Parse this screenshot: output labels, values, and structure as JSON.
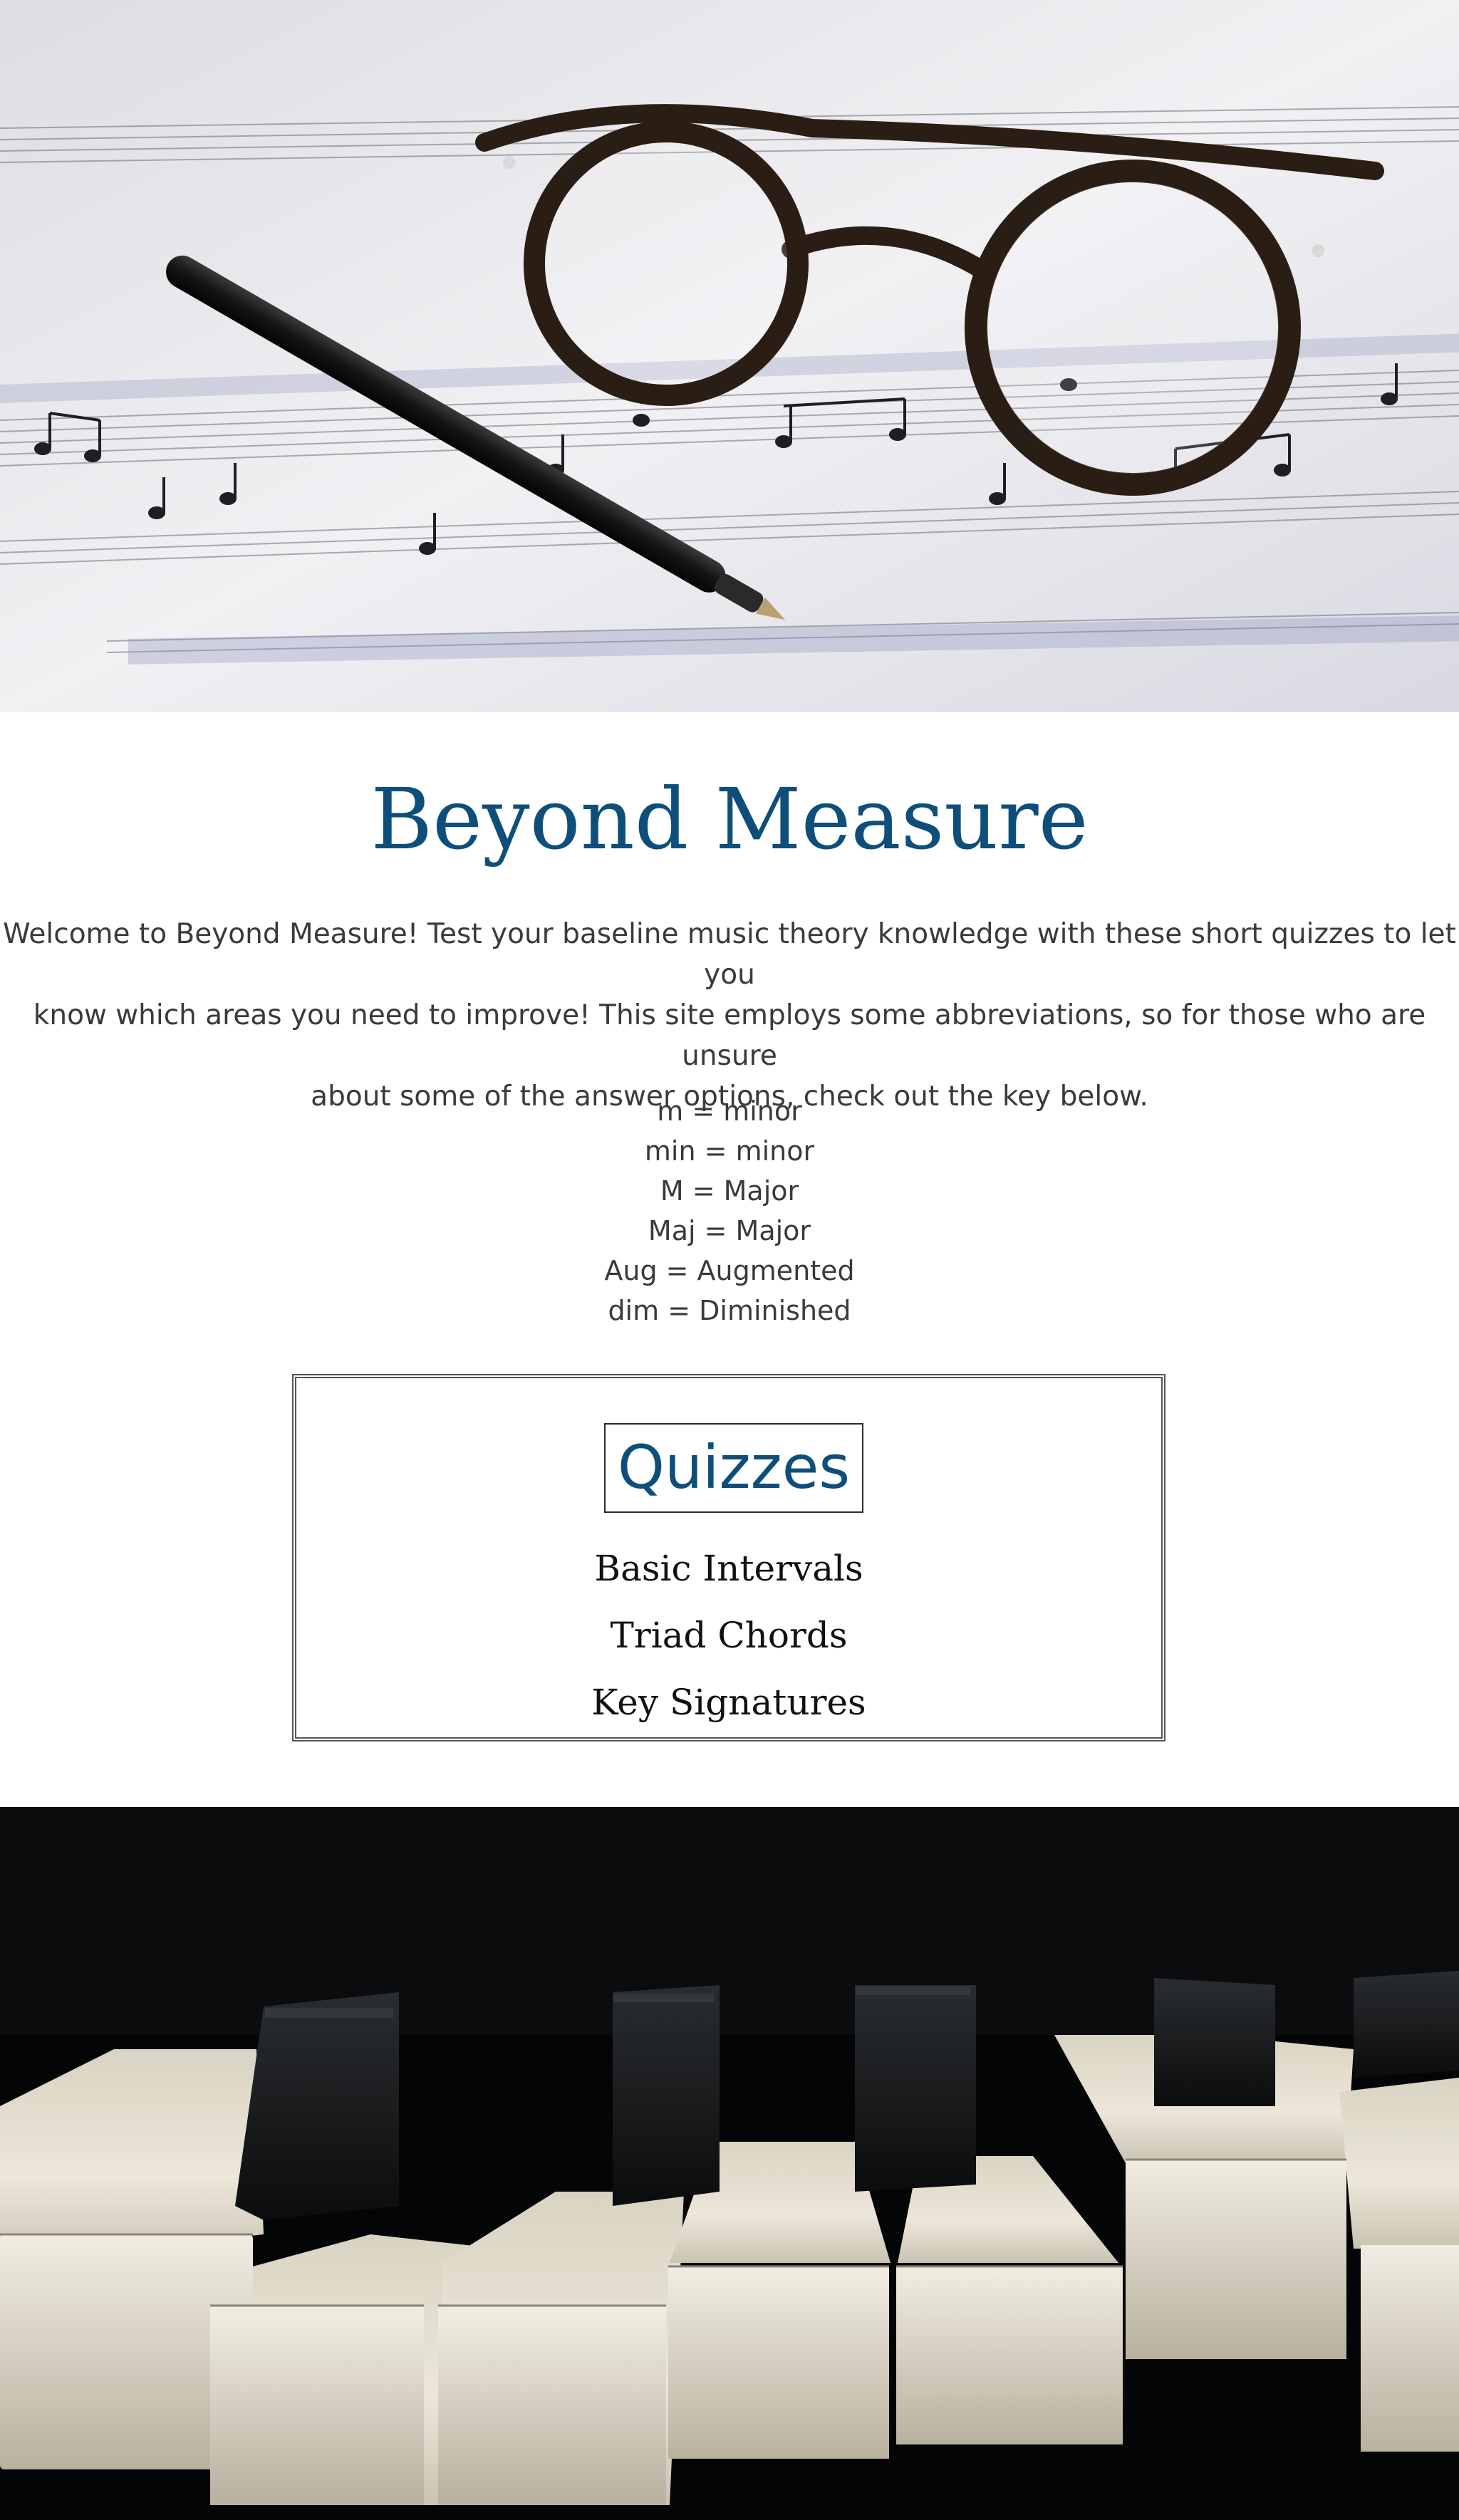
{
  "hero_image": {
    "icon": "sheet-music-glasses-pen-photo"
  },
  "title": "Beyond Measure",
  "intro": {
    "line1": "Welcome to Beyond Measure! Test your baseline music theory knowledge with these short quizzes to let you",
    "line2": "know which areas you need to improve! This site employs some abbreviations, so for those who are unsure",
    "line3": "about some of the answer options, check out the key below."
  },
  "key": [
    "m = minor",
    "min = minor",
    "M = Major",
    "Maj = Major",
    "Aug = Augmented",
    "dim = Diminished"
  ],
  "quizzes": {
    "heading": "Quizzes",
    "items": [
      {
        "label": "Basic Intervals"
      },
      {
        "label": "Triad Chords"
      },
      {
        "label": "Key Signatures"
      }
    ]
  },
  "footer_image": {
    "icon": "piano-keys-photo"
  },
  "colors": {
    "title": "#0d4f7a",
    "text": "#3a3a3a",
    "border": "#555555"
  }
}
